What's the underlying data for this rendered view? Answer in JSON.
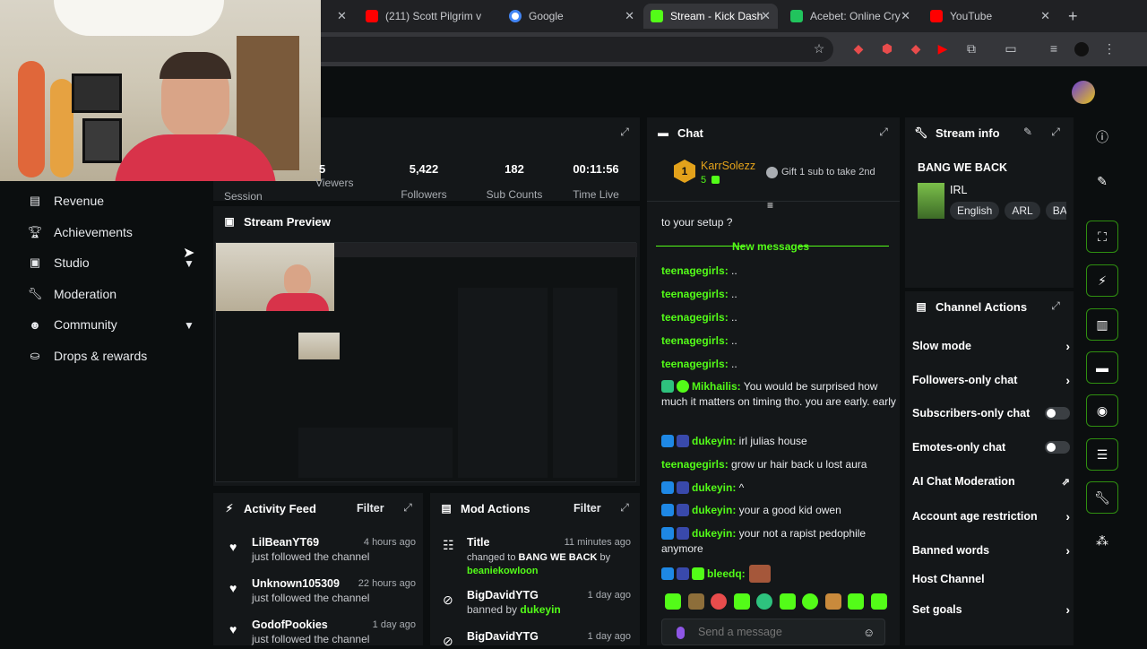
{
  "browser": {
    "tabs": [
      {
        "title": "(211) Scott Pilgrim v",
        "color": "#ff0000"
      },
      {
        "title": "Google",
        "color": "#4285f4"
      },
      {
        "title": "Stream - Kick Dash",
        "color": "#53fc18"
      },
      {
        "title": "Acebet: Online Cry",
        "color": "#21c45d"
      },
      {
        "title": "YouTube",
        "color": "#ff0000"
      }
    ],
    "new_tab": "+"
  },
  "sidebar": {
    "items": [
      {
        "label": "Revenue",
        "icon": "revenue-icon"
      },
      {
        "label": "Achievements",
        "icon": "trophy-icon"
      },
      {
        "label": "Studio",
        "icon": "studio-icon"
      },
      {
        "label": "Moderation",
        "icon": "wrench-icon"
      },
      {
        "label": "Community",
        "icon": "community-icon"
      },
      {
        "label": "Drops & rewards",
        "icon": "drops-icon"
      }
    ]
  },
  "stats": {
    "session_label": "Session",
    "session_value": "5",
    "viewers": {
      "value": "5,422",
      "label": "Viewers"
    },
    "followers": {
      "value": "182",
      "label": "Followers"
    },
    "subs": {
      "value": "00:11:56",
      "label": "Sub Counts"
    },
    "time": {
      "value": "",
      "label": "Time Live"
    }
  },
  "stream_preview": {
    "title": "Stream Preview"
  },
  "activity_feed": {
    "title": "Activity Feed",
    "filter": "Filter",
    "items": [
      {
        "name": "LilBeanYT69",
        "text": "just followed the channel",
        "time": "4 hours ago"
      },
      {
        "name": "Unknown105309",
        "text": "just followed the channel",
        "time": "22 hours ago"
      },
      {
        "name": "GodofPookies",
        "text": "just followed the channel",
        "time": "1 day ago"
      }
    ]
  },
  "mod_actions": {
    "title": "Mod Actions",
    "filter": "Filter",
    "items": [
      {
        "name": "Title",
        "text_pre": "changed to ",
        "text_bold": "BANG WE BACK",
        "text_mid": " by ",
        "actor": "beaniekowloon",
        "time": "11 minutes ago"
      },
      {
        "name": "BigDavidYTG",
        "text_pre": "banned by ",
        "actor": "dukeyin",
        "time": "1 day ago"
      },
      {
        "name": "BigDavidYTG",
        "time": "1 day ago"
      }
    ]
  },
  "chat": {
    "title": "Chat",
    "pinned": {
      "rank": "1",
      "user": "KarrSolezz",
      "count": "5",
      "gift": "Gift 1 sub to take 2nd"
    },
    "prev_line": "to your setup ?",
    "new_messages": "New messages",
    "messages": [
      {
        "user": "teenagegirls:",
        "text": " .."
      },
      {
        "user": "teenagegirls:",
        "text": " .."
      },
      {
        "user": "teenagegirls:",
        "text": " .."
      },
      {
        "user": "teenagegirls:",
        "text": " .."
      },
      {
        "user": "teenagegirls:",
        "text": " .."
      },
      {
        "user": "Mikhailis:",
        "text": " You would be surprised how much it matters on timing tho. you are early. early"
      },
      {
        "user": "dukeyin:",
        "text": " irl julias house"
      },
      {
        "user": "teenagegirls:",
        "text": " grow ur hair back u lost aura"
      },
      {
        "user": "dukeyin:",
        "text": " ^"
      },
      {
        "user": "dukeyin:",
        "text": " your a good kid owen"
      },
      {
        "user": "dukeyin:",
        "text": " your not a rapist pedophile anymore"
      },
      {
        "user": "bleedq:",
        "text": ""
      }
    ],
    "input_placeholder": "Send a message"
  },
  "stream_info": {
    "title": "Stream info",
    "stream_title": "BANG WE BACK",
    "category": "IRL",
    "tags": [
      "English",
      "ARL",
      "BA"
    ]
  },
  "channel_actions": {
    "title": "Channel Actions",
    "items": [
      {
        "label": "Slow mode",
        "control": "arrow"
      },
      {
        "label": "Followers-only chat",
        "control": "arrow"
      },
      {
        "label": "Subscribers-only chat",
        "control": "toggle"
      },
      {
        "label": "Emotes-only chat",
        "control": "toggle"
      },
      {
        "label": "AI Chat Moderation",
        "control": "external"
      },
      {
        "label": "Account age restriction",
        "control": "arrow"
      },
      {
        "label": "Banned words",
        "control": "arrow"
      },
      {
        "label": "Host Channel",
        "control": "none"
      },
      {
        "label": "Set goals",
        "control": "arrow"
      }
    ]
  },
  "colors": {
    "accent": "#53fc18",
    "panel": "#141719",
    "background": "#0b0e0f"
  }
}
